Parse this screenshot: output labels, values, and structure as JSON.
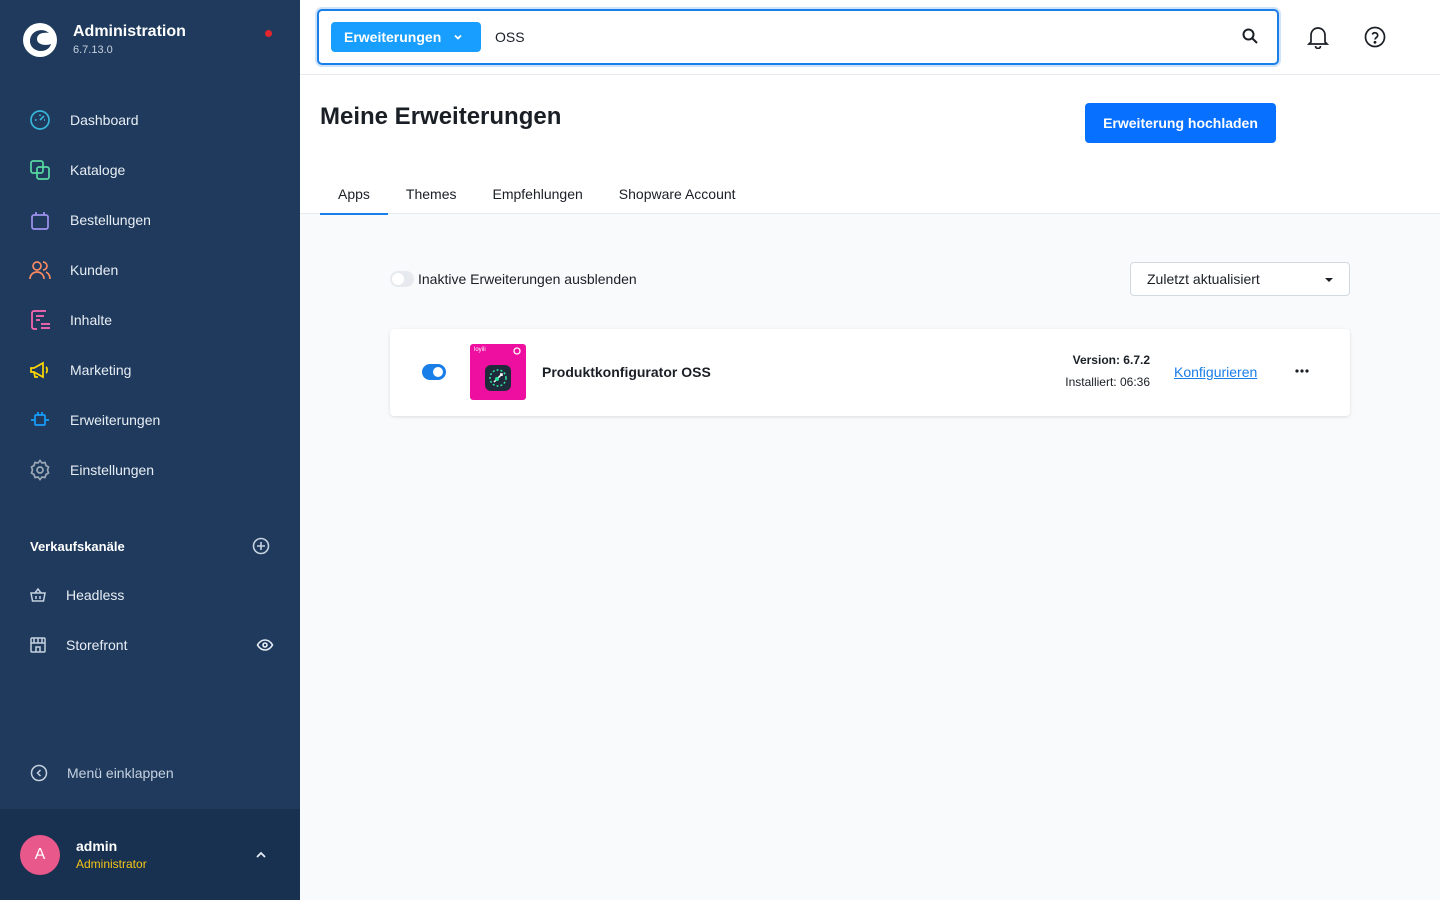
{
  "sidebar": {
    "title": "Administration",
    "version": "6.7.13.0",
    "nav": [
      {
        "label": "Dashboard",
        "icon": "dashboard-icon",
        "color": "#37b3d8"
      },
      {
        "label": "Kataloge",
        "icon": "catalog-icon",
        "color": "#57d9a3"
      },
      {
        "label": "Bestellungen",
        "icon": "orders-icon",
        "color": "#a092f0"
      },
      {
        "label": "Kunden",
        "icon": "customers-icon",
        "color": "#f88962"
      },
      {
        "label": "Inhalte",
        "icon": "content-icon",
        "color": "#ff68b4"
      },
      {
        "label": "Marketing",
        "icon": "marketing-icon",
        "color": "#ffd700"
      },
      {
        "label": "Erweiterungen",
        "icon": "extensions-icon",
        "color": "#189eff"
      },
      {
        "label": "Einstellungen",
        "icon": "settings-icon",
        "color": "#9aa8b5"
      }
    ],
    "sales_title": "Verkaufskanäle",
    "sales": [
      {
        "label": "Headless",
        "icon": "basket-icon"
      },
      {
        "label": "Storefront",
        "icon": "storefront-icon"
      }
    ],
    "collapse_label": "Menü einklappen",
    "user": {
      "initial": "A",
      "name": "admin",
      "role": "Administrator"
    }
  },
  "topbar": {
    "search_type": "Erweiterungen",
    "search_value": "OSS"
  },
  "header": {
    "title": "Meine Erweiterungen",
    "upload_label": "Erweiterung hochladen",
    "tabs": [
      "Apps",
      "Themes",
      "Empfehlungen",
      "Shopware Account"
    ],
    "active_tab": "Apps"
  },
  "filters": {
    "hide_inactive_label": "Inaktive Erweiterungen ausblenden",
    "hide_inactive": false,
    "sort_value": "Zuletzt aktualisiert"
  },
  "extensions": [
    {
      "name": "Produktkonfigurator OSS",
      "active": true,
      "version": "Version: 6.7.2",
      "installed": "Installiert: 06:36",
      "configure_label": "Konfigurieren",
      "icon_brand": "loyili",
      "icon_color": "#ee0ea0"
    }
  ],
  "colors": {
    "sidebar": "#1f3a5c",
    "primary": "#0870ff",
    "accent": "#189eff",
    "link": "#1a7ee8"
  }
}
